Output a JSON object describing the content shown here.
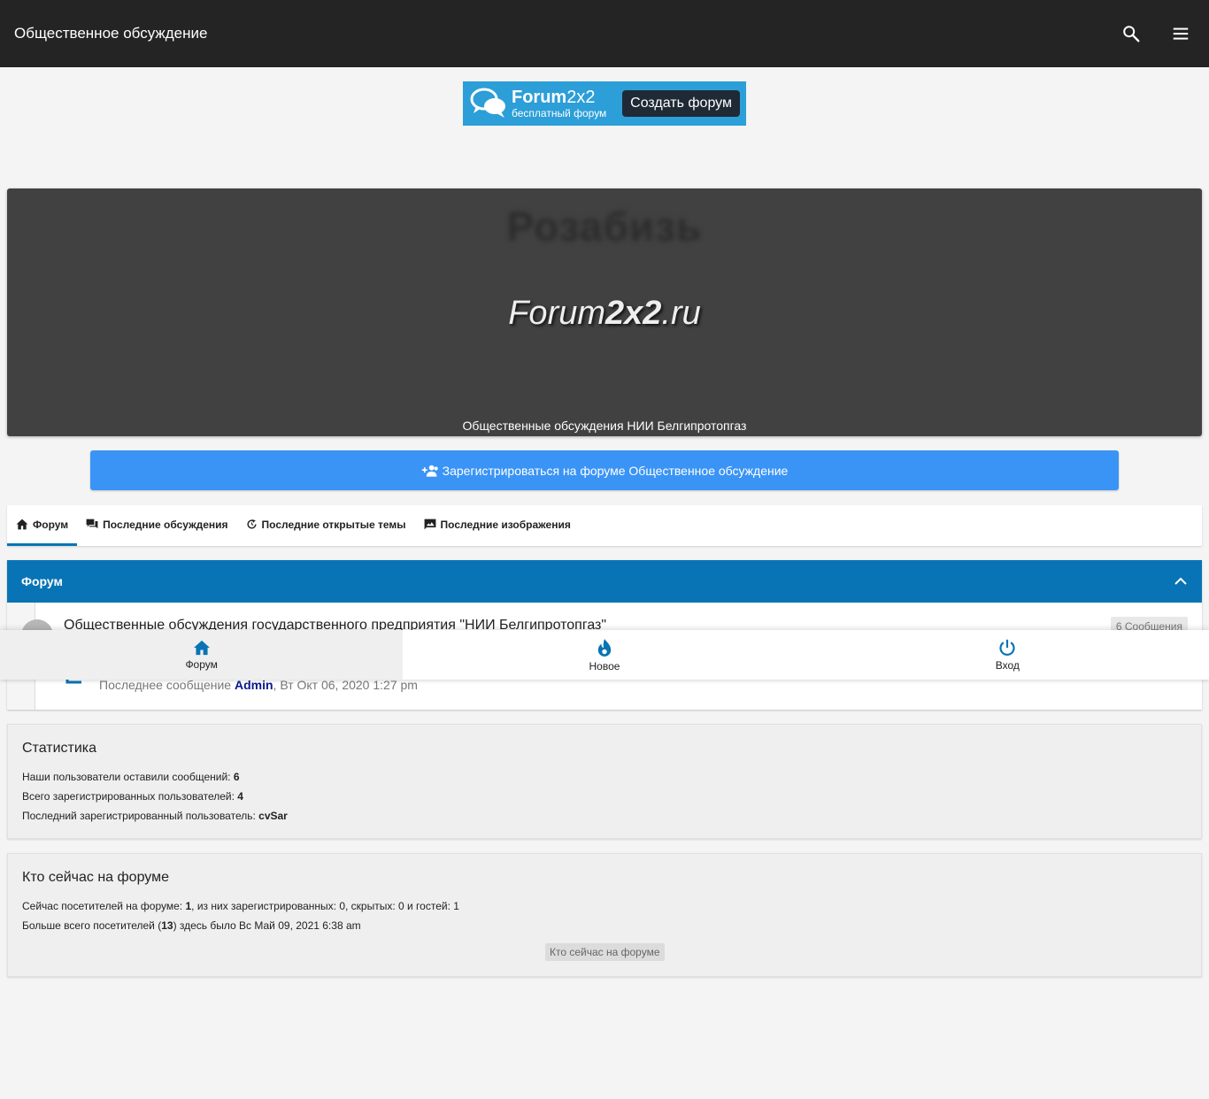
{
  "topbar": {
    "title": "Общественное обсуждение",
    "search_icon": "search-icon",
    "menu_icon": "menu-icon"
  },
  "ad": {
    "brand_bold": "Forum",
    "brand_light": "2x2",
    "subtitle": "бесплатный форум",
    "button": "Создать форум",
    "color": "#2c9ed8"
  },
  "hero": {
    "ghost_text": "Розабизь",
    "logo_part1": "Forum",
    "logo_bold": "2x2",
    "logo_part2": ".ru",
    "description": "Общественные обсуждения НИИ Белгипротопгаз"
  },
  "register": {
    "icon": "add-users-icon",
    "label": "Зарегистрироваться на форуме Общественное обсуждение",
    "color": "#3a94f5"
  },
  "tabs": [
    {
      "label": "Форум",
      "icon": "home-icon",
      "active": true
    },
    {
      "label": "Последние обсуждения",
      "icon": "forum-chat-icon",
      "active": false
    },
    {
      "label": "Последние открытые темы",
      "icon": "refresh-icon",
      "active": false
    },
    {
      "label": "Последние изображения",
      "icon": "image-chat-icon",
      "active": false
    }
  ],
  "category": {
    "title": "Форум",
    "color": "#0874b5",
    "forum": {
      "title": "Общественные обсуждения государственного предприятия \"НИИ Белгипротопгаз\"",
      "count": "6 Сообщения",
      "lastpost_label": "Последнее сообщение",
      "lastpost_author": "Admin",
      "lastpost_date": ", Вт Окт 06, 2020 1:27 pm"
    }
  },
  "bottom_nav": [
    {
      "label": "Форум",
      "icon": "home-icon",
      "active": true
    },
    {
      "label": "Новое",
      "icon": "fire-icon",
      "active": false
    },
    {
      "label": "Вход",
      "icon": "power-icon",
      "active": false
    }
  ],
  "stats": {
    "title": "Статистика",
    "posts_label": "Наши пользователи оставили сообщений: ",
    "posts_value": "6",
    "users_label": "Всего зарегистрированных пользователей: ",
    "users_value": "4",
    "last_user_label": "Последний зарегистрированный пользователь: ",
    "last_user_value": "cvSar"
  },
  "online": {
    "title": "Кто сейчас на форуме",
    "now_label": "Сейчас посетителей на форуме: ",
    "now_value": "1",
    "now_rest": ", из них зарегистрированных: 0, скрытых: 0 и гостей: 1",
    "max_prefix": "Больше всего посетителей (",
    "max_value": "13",
    "max_suffix": ") здесь было Вс Май 09, 2021 6:38 am",
    "button": "Кто сейчас на форуме"
  }
}
